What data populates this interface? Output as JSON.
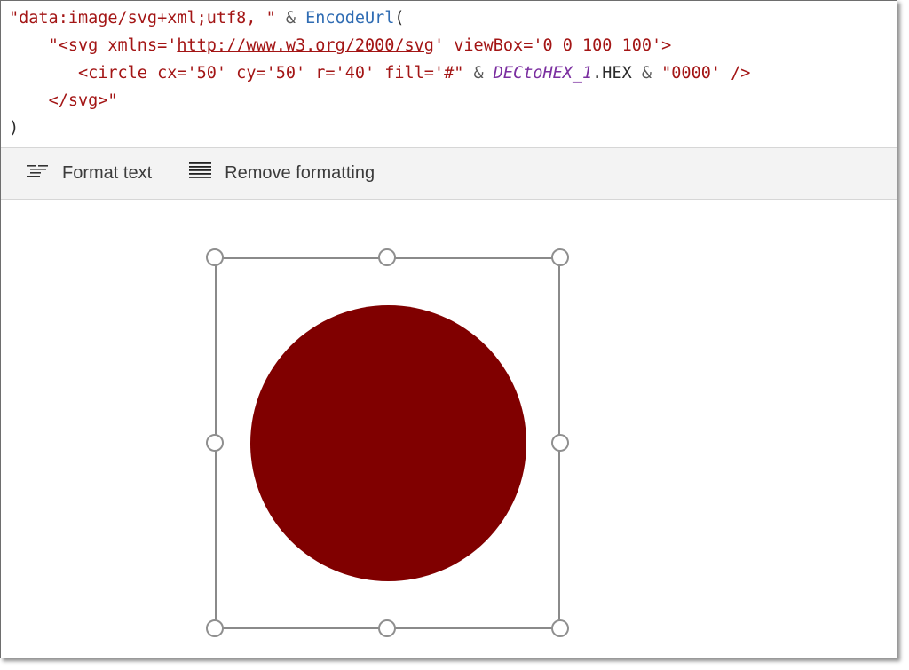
{
  "formula": {
    "line1": {
      "string1": "\"data:image/svg+xml;utf8, \"",
      "op": " & ",
      "function": "EncodeUrl",
      "paren": "("
    },
    "line2": {
      "prefix": "\"<svg xmlns='",
      "link": "http://www.w3.org/2000/svg",
      "suffix": "' viewBox='0 0 100 100'>"
    },
    "line3": {
      "string1": "<circle cx='50' cy='50' r='40' fill='#\"",
      "op1": " & ",
      "variable": "DECtoHEX_1",
      "property": ".HEX",
      "op2": " & ",
      "string2": "\"0000' />"
    },
    "line4": {
      "text": "</svg>\""
    },
    "line5": {
      "text": ")"
    }
  },
  "toolbar": {
    "format_text_label": "Format text",
    "remove_formatting_label": "Remove formatting"
  },
  "canvas": {
    "circle_fill": "#800000",
    "selection_color": "#8a8a8a"
  }
}
